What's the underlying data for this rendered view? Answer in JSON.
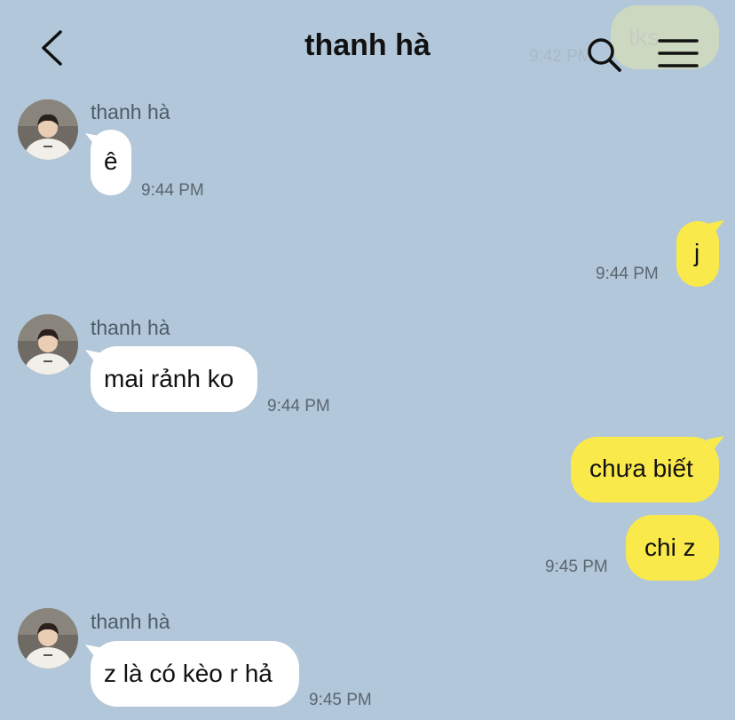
{
  "header": {
    "title": "thanh hà",
    "icons": {
      "back": "back-chevron-icon",
      "search": "search-icon",
      "menu": "hamburger-menu-icon"
    }
  },
  "ghost": {
    "text": "tks",
    "time": "9:42 PM"
  },
  "colors": {
    "background": "#b2c7d9",
    "incoming_bubble": "#ffffff",
    "outgoing_bubble": "#fae94b",
    "text": "#111111",
    "timestamp": "#5b6670"
  },
  "messages": [
    {
      "sender": "thanh hà",
      "text": "ê",
      "time": "9:44 PM"
    },
    {
      "text": "j",
      "time": "9:44 PM"
    },
    {
      "sender": "thanh hà",
      "text": "mai rảnh ko",
      "time": "9:44 PM"
    },
    {
      "text": "chưa biết",
      "time": ""
    },
    {
      "text": "chi z",
      "time": "9:45 PM"
    },
    {
      "sender": "thanh hà",
      "text": "z là có kèo r hả",
      "time": "9:45 PM"
    }
  ]
}
